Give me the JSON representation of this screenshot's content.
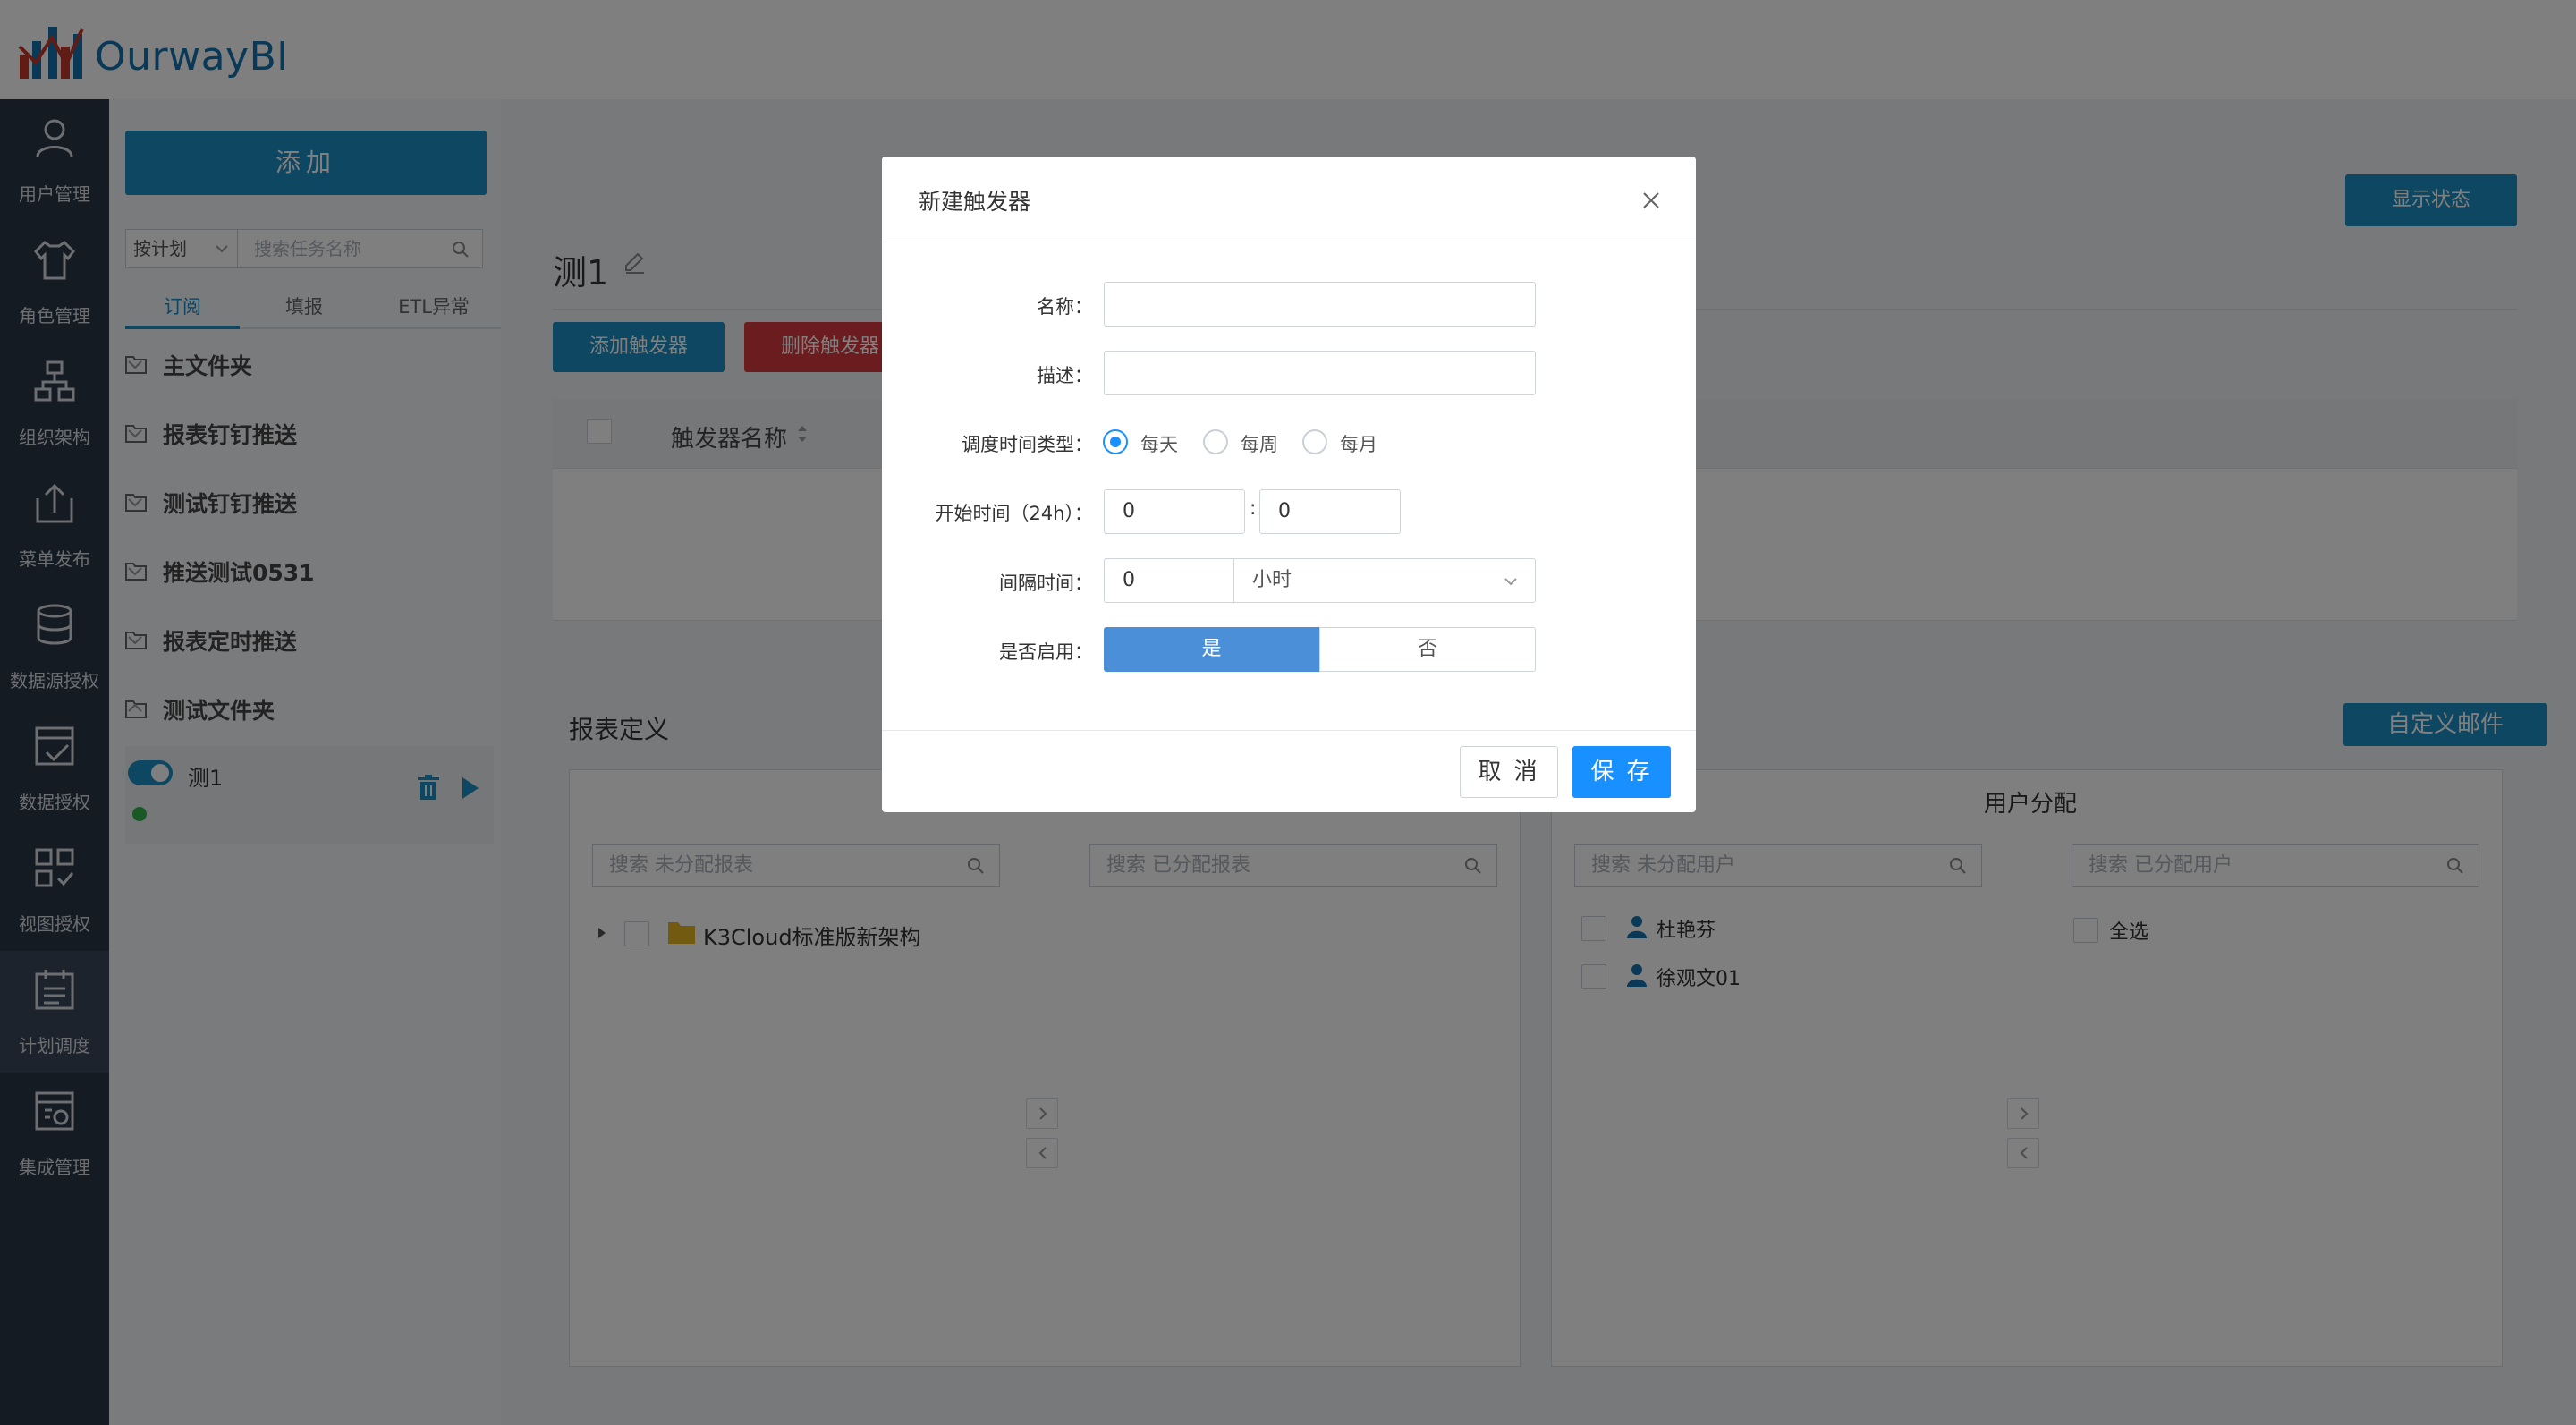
{
  "app": {
    "brand": "OurwayBI"
  },
  "sidebar": {
    "items": [
      {
        "label": "用户管理",
        "icon": "user-icon"
      },
      {
        "label": "角色管理",
        "icon": "shirt-icon"
      },
      {
        "label": "组织架构",
        "icon": "org-chart-icon"
      },
      {
        "label": "菜单发布",
        "icon": "upload-icon"
      },
      {
        "label": "数据源授权",
        "icon": "database-icon"
      },
      {
        "label": "数据授权",
        "icon": "data-check-icon"
      },
      {
        "label": "视图授权",
        "icon": "view-grid-icon"
      },
      {
        "label": "计划调度",
        "icon": "schedule-icon"
      },
      {
        "label": "集成管理",
        "icon": "integration-icon"
      }
    ],
    "active_index": 7
  },
  "left_panel": {
    "add_label": "添加",
    "plan_select": "按计划",
    "search_placeholder": "搜索任务名称",
    "tabs": [
      "订阅",
      "填报",
      "ETL异常"
    ],
    "folders": [
      "主文件夹",
      "报表钉钉推送",
      "测试钉钉推送",
      "推送测试0531",
      "报表定时推送",
      "测试文件夹"
    ],
    "task": {
      "name": "测1",
      "enabled": true,
      "status_color": "#31b34b"
    }
  },
  "main": {
    "show_status_label": "显示状态",
    "task_title": "测1",
    "add_trigger_label": "添加触发器",
    "delete_trigger_label": "删除触发器",
    "grid_column": "触发器名称",
    "report_def_title": "报表定义",
    "custom_mail_label": "自定义邮件",
    "report_panel": {
      "search_unassigned": "搜索 未分配报表",
      "search_assigned": "搜索 已分配报表",
      "tree_root": "K3Cloud标准版新架构"
    },
    "user_panel": {
      "title": "用户分配",
      "search_unassigned": "搜索 未分配用户",
      "search_assigned": "搜索 已分配用户",
      "users": [
        "杜艳芬",
        "徐观文01"
      ],
      "select_all": "全选"
    }
  },
  "modal": {
    "title": "新建触发器",
    "name_label": "名称：",
    "name_value": "",
    "desc_label": "描述：",
    "desc_value": "",
    "schedule_type_label": "调度时间类型：",
    "schedule_options": [
      "每天",
      "每周",
      "每月"
    ],
    "schedule_selected": "每天",
    "start_time_label": "开始时间（24h）：",
    "start_hour": "0",
    "start_separator": ":",
    "start_minute": "0",
    "interval_label": "间隔时间：",
    "interval_value": "0",
    "interval_unit": "小时",
    "enabled_label": "是否启用：",
    "enabled_yes": "是",
    "enabled_no": "否",
    "cancel_label": "取 消",
    "save_label": "保 存"
  },
  "colors": {
    "accent": "#1a8ec5",
    "primary": "#1890ff",
    "danger": "#d6383d",
    "sidebar_bg": "#2a3646"
  }
}
